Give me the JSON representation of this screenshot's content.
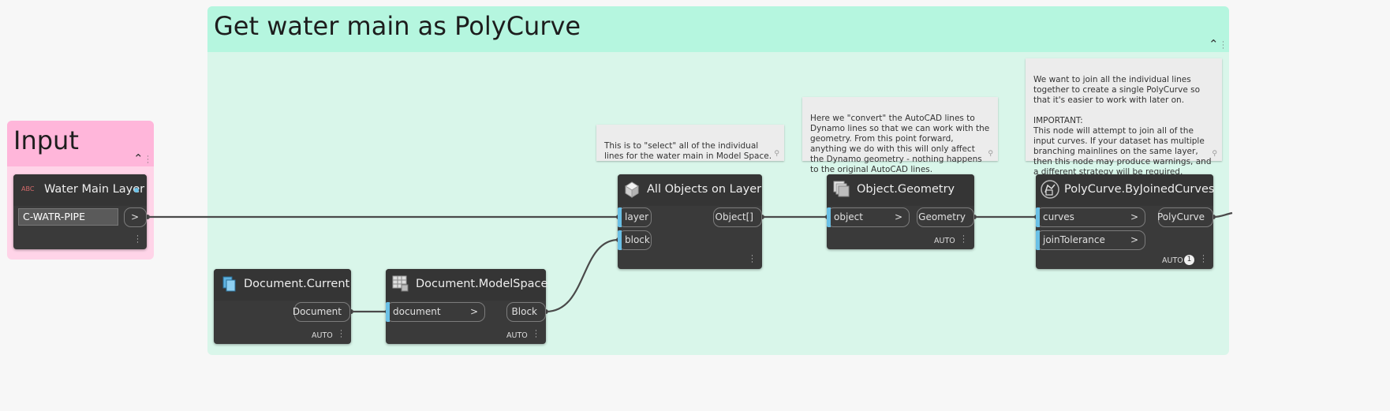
{
  "groups": {
    "main": {
      "title": "Get water main as PolyCurve"
    },
    "input": {
      "title": "Input"
    }
  },
  "nodes": {
    "water_main_layer": {
      "badge": "ABC",
      "title": "Water Main Layer",
      "value": "C-WATR-PIPE",
      "out": ">"
    },
    "document_current": {
      "title": "Document.Current",
      "out": "Document",
      "lacing": "AUTO"
    },
    "document_modelspace": {
      "title": "Document.ModelSpace",
      "in": "document",
      "out": "Block",
      "lacing": "AUTO"
    },
    "all_objects": {
      "title": "All Objects on Layer",
      "in1": "layer",
      "in2": "block",
      "out": "Object[]"
    },
    "object_geometry": {
      "title": "Object.Geometry",
      "in": "object",
      "out": "Geometry",
      "lacing": "AUTO"
    },
    "polycurve": {
      "title": "PolyCurve.ByJoinedCurves",
      "in1": "curves",
      "in2": "joinTolerance",
      "out": "PolyCurve",
      "lacing": "AUTO",
      "badge_count": "1"
    }
  },
  "notes": {
    "select": "This is to \"select\" all of the individual lines for the water main in Model Space.",
    "convert": "Here we \"convert\" the AutoCAD lines to Dynamo lines so that we can work with the geometry. From this point forward, anything we do with this will only affect the Dynamo geometry - nothing happens to the original AutoCAD lines.",
    "join": "We want to join all the individual lines together to create a single PolyCurve so that it's easier to work with later on.\n\nIMPORTANT:\nThis node will attempt to join all of the input curves. If your dataset has multiple branching mainlines on the same layer, then this node may produce warnings, and a different strategy will be required."
  },
  "colors": {
    "main_group_header": "#b5f6df",
    "main_group_body": "#d9f6ea",
    "input_group_header": "#ffb6da",
    "input_group_body": "#ffd4e8",
    "node_bg": "#3a3a3a",
    "port_accent": "#6ac0e6"
  }
}
